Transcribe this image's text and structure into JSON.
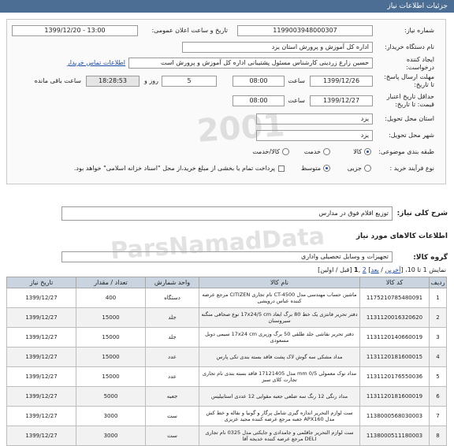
{
  "header": {
    "title": "جزئیات اطلاعات نیاز"
  },
  "form": {
    "need_number_label": "شماره نیاز:",
    "need_number": "1199003948000307",
    "announce_label": "تاریخ و ساعت اعلان عمومی:",
    "announce_value": "1399/12/20 - 13:00",
    "buyer_label": "نام دستگاه خریدار:",
    "buyer_value": "اداره کل آموزش و پرورش استان یزد",
    "creator_label_1": "ایجاد کننده",
    "creator_label_2": "درخواست:",
    "creator_value": "حسین زارع زردینی  کارشناس مسئول پشتیبانی  اداره کل آموزش و پرورش است",
    "contact_link": "اطلاعات تماس خریدار",
    "deadline_label_1": "مهلت ارسال پاسخ:",
    "deadline_label_2": "تا تاریخ:",
    "deadline_date": "1399/12/26",
    "deadline_time_label": "ساعت",
    "deadline_time": "08:00",
    "days": "5",
    "days_label": "روز و",
    "remaining_time": "18:28:53",
    "remaining_label": "ساعت باقی مانده",
    "validity_label_1": "حداقل تاریخ اعتبار",
    "validity_label_2": "قیمت: تا تاریخ:",
    "validity_date": "1399/12/27",
    "validity_time_label": "ساعت",
    "validity_time": "08:00",
    "province_label": "استان محل تحویل:",
    "province_value": "یزد",
    "city_label": "شهر محل تحویل:",
    "city_value": "یزد",
    "subject_label": "طبقه بندی موضوعی:",
    "subject_options": [
      "کالا",
      "خدمت",
      "کالا/خدمت"
    ],
    "purchase_label": "نوع فرآیند خرید :",
    "purchase_options": [
      "جزیی",
      "متوسط"
    ],
    "payment_note": "پرداخت تمام یا بخشی از مبلغ خرید،از محل \"اسناد خزانه اسلامی\" خواهد بود."
  },
  "summary": {
    "label": "شرح کلی نیاز:",
    "value": "توزیع اقلام فوق در مدارس"
  },
  "goods_section": {
    "title": "اطلاعات کالاهای مورد نیاز",
    "group_label": "گروه کالا:",
    "group_value": "تجهیزات و وسایل تحصیلی واداری",
    "pager_prefix": "نمایش 1 تا 10، [",
    "pager_last": "آخرین",
    "pager_sep": " / ",
    "pager_next": "بعد",
    "pager_mid": "] ",
    "pager_page2": "2",
    "pager_comma": " ,",
    "pager_page1": "1",
    "pager_rest": " [قبل / اولین]"
  },
  "table": {
    "headers": [
      "ردیف",
      "کد کالا",
      "نام کالا",
      "واحد شمارش",
      "تعداد / مقدار",
      "تاریخ نیاز"
    ],
    "rows": [
      {
        "row": "1",
        "code": "1175210785480091",
        "name": "ماشین حساب مهندسی مدل CT-4500 نام تجاری CITIZEN مرجع عرضه کننده عباس درویشی",
        "unit": "دستگاه",
        "qty": "400",
        "date": "1399/12/27"
      },
      {
        "row": "2",
        "code": "1131120016320620",
        "name": "دفتر تحریر فانتزی یک خط 80 برگ ابعاد 17x24/5 cm نوع صحافی منگنه سیروسنان",
        "unit": "جلد",
        "qty": "15000",
        "date": "1399/12/27"
      },
      {
        "row": "3",
        "code": "1131120140660019",
        "name": "دفتر تحریر نقاشی جلد طلقی 50 برگ وزیری 17x24 cm سیمی دوبل مسعودی",
        "unit": "جلد",
        "qty": "15000",
        "date": "1399/12/27"
      },
      {
        "row": "4",
        "code": "1131120181600015",
        "name": "مداد مشکی سه گوش لاک پشت فاقد بسته بندی تکی پارس",
        "unit": "عدد",
        "qty": "15000",
        "date": "1399/12/27"
      },
      {
        "row": "5",
        "code": "1131120176550036",
        "name": "مداد نوک معمولی 0/5 mm مدل 17121405 فاقد بسته بندی نام تجاری تجارت کلای سبز",
        "unit": "عدد",
        "qty": "15000",
        "date": "1399/12/27"
      },
      {
        "row": "6",
        "code": "1131120181600019",
        "name": "مداد رنگی 12 رنگ سه ضلعی جعبه مقوایی 12 عددی استابیلیس",
        "unit": "جعبه",
        "qty": "5000",
        "date": "1399/12/27"
      },
      {
        "row": "7",
        "code": "1138000568030003",
        "name": "ست لوازم التحریر اندازه گیری شامل پرگار و گونیا و نقاله و خط کش مدل APX160 جعبه مرجع عرضه کننده مجید عزیزی",
        "unit": "ست",
        "qty": "3000",
        "date": "1399/12/27"
      },
      {
        "row": "8",
        "code": "1138000511180003",
        "name": "ست لوازم التحریر جاقلمی و جامدادی و جایکتی مدل 0325 نام تجاری DELI مرجع عرضه کننده خدیجه آقا",
        "unit": "ست",
        "qty": "3000",
        "date": "1399/12/27"
      }
    ]
  },
  "watermark": {
    "text1": "ParsNamadData",
    "text2": "2001"
  }
}
